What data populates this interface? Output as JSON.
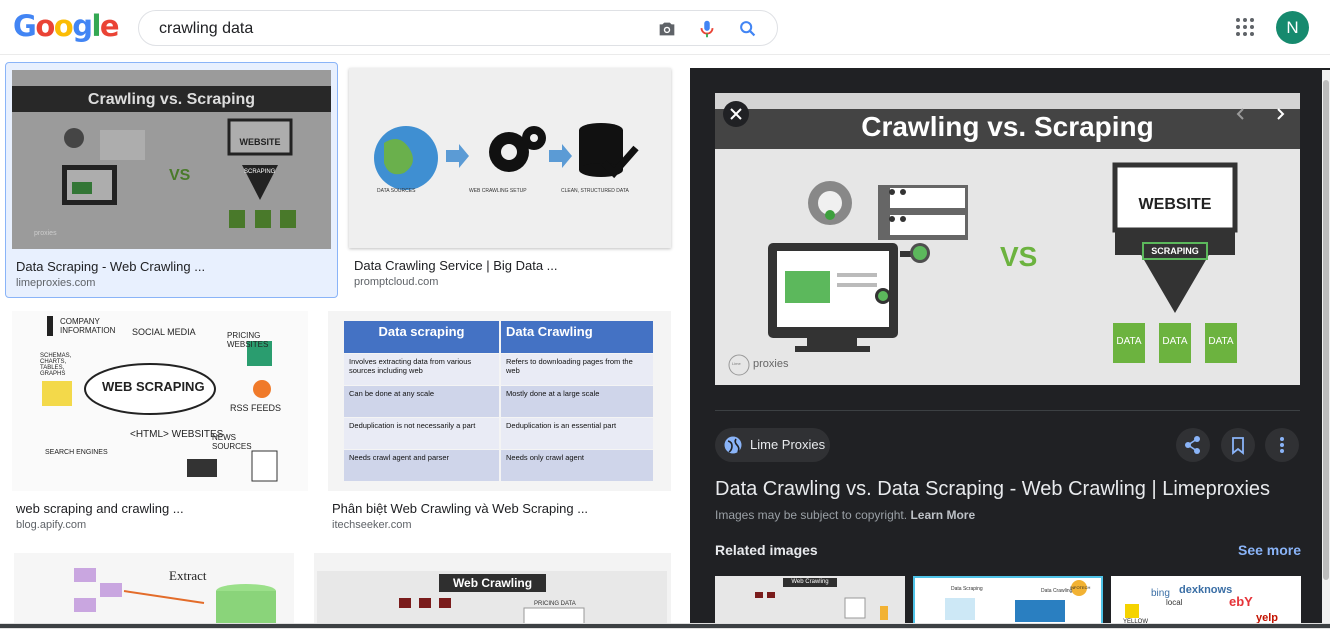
{
  "logo": {
    "letters": [
      "G",
      "o",
      "o",
      "g",
      "l",
      "e"
    ],
    "colors": [
      "#4285F4",
      "#EA4335",
      "#FBBC05",
      "#4285F4",
      "#34A853",
      "#EA4335"
    ]
  },
  "search": {
    "query": "crawling data"
  },
  "account": {
    "initial": "N",
    "color": "#168a6e"
  },
  "results": [
    {
      "title": "Data Scraping - Web Crawling ...",
      "source": "limeproxies.com",
      "selected": true,
      "thumb": {
        "heading": "Crawling vs. Scraping",
        "vs": "VS",
        "website": "WEBSITE",
        "scraping": "SCRAPING",
        "data": "DATA",
        "brand": "proxies"
      }
    },
    {
      "title": "Data Crawling Service | Big Data ...",
      "source": "promptcloud.com",
      "thumb": {
        "labels": [
          "DATA SOURCES",
          "WEB CRAWLING SETUP",
          "CLEAN, STRUCTURED DATA"
        ]
      }
    },
    {
      "title": "web scraping and crawling ...",
      "source": "blog.apify.com",
      "thumb": {
        "words": [
          "COMPANY INFORMATION",
          "SOCIAL MEDIA",
          "PRICING WEBSITES",
          "SCHEMAS, CHARTS, TABLES, GRAPHS",
          "WEB SCRAPING",
          "RSS FEEDS",
          "<HTML> WEBSITES",
          "NEWS SOURCES",
          "SEARCH ENGINES"
        ]
      }
    },
    {
      "title": "Phân biệt Web Crawling và Web Scraping ...",
      "source": "itechseeker.com",
      "thumb": {
        "headers": [
          "Data scraping",
          "Data Crawling"
        ],
        "rows": [
          [
            "Involves extracting data from various sources including web",
            "Refers to downloading pages from the web"
          ],
          [
            "Can be done at any scale",
            "Mostly done at a large scale"
          ],
          [
            "Deduplication is not necessarily a part",
            "Deduplication is an essential part"
          ],
          [
            "Needs crawl agent and parser",
            "Needs only crawl agent"
          ]
        ]
      }
    },
    {
      "title": "",
      "source": "",
      "thumb": {
        "word": "Extract"
      }
    },
    {
      "title": "",
      "source": "",
      "thumb": {
        "word": "Web Crawling",
        "sub": "PRICING DATA"
      }
    }
  ],
  "panel": {
    "preview": {
      "heading": "Crawling vs. Scraping",
      "vs": "VS",
      "website": "WEBSITE",
      "scraping": "SCRAPING",
      "data": "DATA",
      "brand": "proxies",
      "brand_prefix": "Lime"
    },
    "source_chip": "Lime Proxies",
    "title": "Data Crawling vs. Data Scraping - Web Crawling | Limeproxies",
    "copyright": "Images may be subject to copyright.",
    "learn_more": "Learn More",
    "related_label": "Related images",
    "see_more": "See more",
    "related": [
      {
        "label": "Web Crawling"
      },
      {
        "labels": [
          "Data Scraping",
          "Data Crawling",
          "INFOTECH"
        ]
      },
      {
        "labels": [
          "bing",
          "local",
          "dexknows",
          "ebY",
          "YELLOW",
          "yelp"
        ]
      }
    ]
  }
}
